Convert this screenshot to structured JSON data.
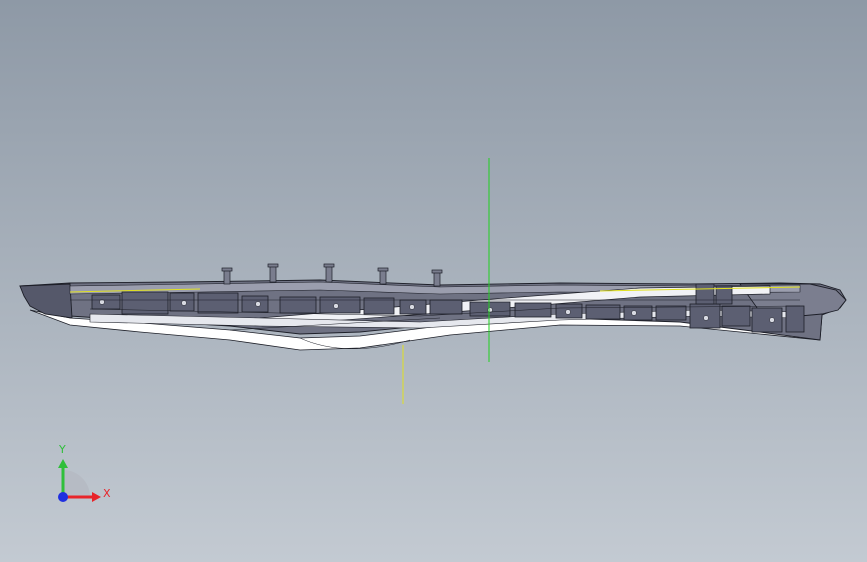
{
  "viewport": {
    "background_top": "#8e99a6",
    "background_bottom": "#c3cad2",
    "model_color": "#6f7283",
    "model_highlight": "#f1f2f6",
    "edge_color": "#1d1f28"
  },
  "reference_axes": {
    "vertical_green_color": "#1fd11f",
    "vertical_yellow_color": "#e0e020"
  },
  "triad": {
    "x_label": "X",
    "y_label": "Y",
    "x_color": "#e8242a",
    "y_color": "#2fbf3a",
    "z_color": "#1f2fe0"
  }
}
